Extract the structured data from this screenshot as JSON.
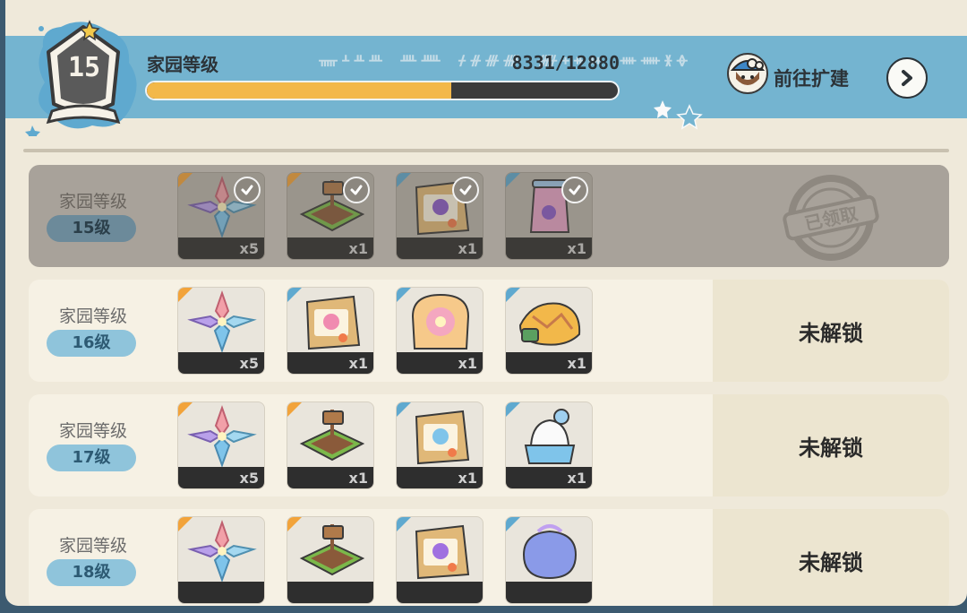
{
  "header": {
    "deco_text": "ᚅᚆᚇᚈ ᚉᚊ ᚋᚌᚍᚎ ᚏᚐᚑᚒ ᚓᚔᚕᚖ",
    "title": "家园等级",
    "current_level": "15",
    "exp_text": "8331/12880",
    "exp_fraction": 0.647,
    "expand_label": "前往扩建"
  },
  "rows": [
    {
      "label": "家园等级",
      "level": "15级",
      "state": "claimed",
      "stamp_text": "已领取",
      "items": [
        {
          "icon": "crystal-leaf-icon",
          "qty": "x5",
          "corner": "orange"
        },
        {
          "icon": "garden-plot-sign-icon",
          "qty": "x1",
          "corner": "orange"
        },
        {
          "icon": "purple-flower-seed-bag-icon",
          "qty": "x1",
          "corner": "blue"
        },
        {
          "icon": "flower-jar-icon",
          "qty": "x1",
          "corner": "blue"
        }
      ]
    },
    {
      "label": "家园等级",
      "level": "16级",
      "state": "locked",
      "status_text": "未解锁",
      "items": [
        {
          "icon": "crystal-leaf-icon",
          "qty": "x5",
          "corner": "orange"
        },
        {
          "icon": "pink-flower-seed-bag-icon",
          "qty": "x1",
          "corner": "blue"
        },
        {
          "icon": "flower-toast-icon",
          "qty": "x1",
          "corner": "blue"
        },
        {
          "icon": "patchwork-cushion-icon",
          "qty": "x1",
          "corner": "blue"
        }
      ]
    },
    {
      "label": "家园等级",
      "level": "17级",
      "state": "locked",
      "status_text": "未解锁",
      "items": [
        {
          "icon": "crystal-leaf-icon",
          "qty": "x5",
          "corner": "orange"
        },
        {
          "icon": "garden-plot-sign-icon",
          "qty": "x1",
          "corner": "orange"
        },
        {
          "icon": "blue-flower-seed-bag-icon",
          "qty": "x1",
          "corner": "blue"
        },
        {
          "icon": "cream-pudding-icon",
          "qty": "x1",
          "corner": "blue"
        }
      ]
    },
    {
      "label": "家园等级",
      "level": "18级",
      "state": "locked",
      "status_text": "未解锁",
      "items": [
        {
          "icon": "crystal-leaf-icon",
          "qty": "",
          "corner": "orange"
        },
        {
          "icon": "garden-plot-sign-icon",
          "qty": "",
          "corner": "orange"
        },
        {
          "icon": "violet-flower-seed-bag-icon",
          "qty": "",
          "corner": "blue"
        },
        {
          "icon": "gift-pouch-icon",
          "qty": "",
          "corner": "blue"
        }
      ]
    }
  ],
  "colors": {
    "header_bg": "#74b4d0",
    "exp_fill": "#f3b84a",
    "panel_bg": "#efe9da"
  }
}
